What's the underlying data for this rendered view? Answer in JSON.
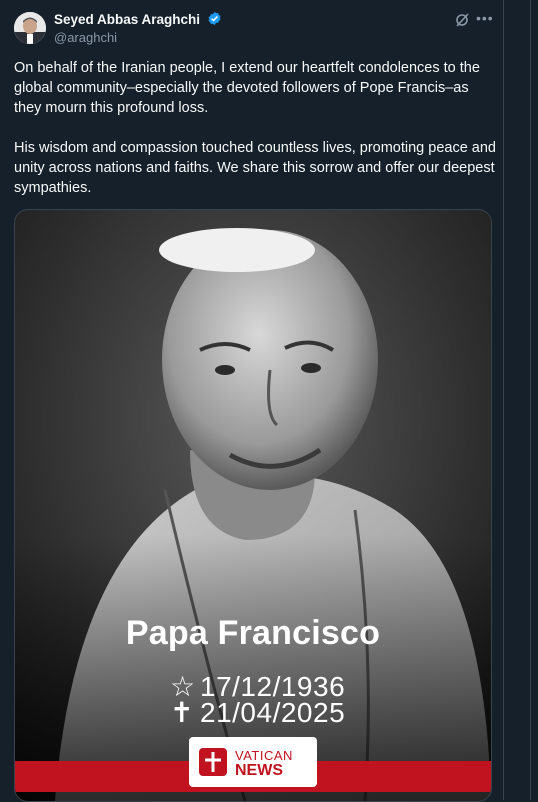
{
  "author": {
    "name": "Seyed Abbas Araghchi",
    "handle": "@araghchi",
    "verified": true
  },
  "tweet": {
    "paragraph_1": "On behalf of the Iranian people, I extend our heartfelt condolences to the global community–especially the devoted followers of Pope Francis–as they mourn this profound loss.",
    "paragraph_2": "His wisdom and compassion touched countless lives, promoting peace and unity across nations and faiths. We share this sorrow and offer our deepest sympathies."
  },
  "media": {
    "title": "Papa Francisco",
    "birth_symbol": "☆",
    "birth_date": "17/12/1936",
    "death_symbol": "✝",
    "death_date": "21/04/2025",
    "logo_top": "VATICAN",
    "logo_bottom": "NEWS"
  },
  "colors": {
    "background": "#15202b",
    "text": "#f7f9f9",
    "muted": "#8b98a5",
    "verified": "#1d9bf0",
    "vatican_red": "#c1121f"
  },
  "icons": {
    "verified": "verified-badge-icon",
    "grok": "grok-icon",
    "more": "more-icon"
  }
}
